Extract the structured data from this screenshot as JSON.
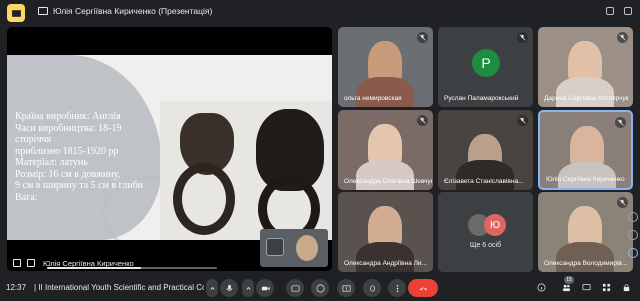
{
  "header": {
    "title": "Юлія Сергіївна Кириченко (Презентація)"
  },
  "slide": {
    "lines": [
      "Країна виробник: Англія",
      "Часи виробництва: 18-19",
      "сторіччя",
      "приблизно 1815-1920 рр",
      "Матеріал: латунь",
      "Розмір: 16 см в довжину,",
      "9 см в ширину та 5 см в глиби",
      "Вага:"
    ]
  },
  "presentation": {
    "presenter_name": "Юлія Сергіївна Кириченко",
    "progress_fraction": 0.55
  },
  "participants": [
    {
      "name": "ольга немировская",
      "muted": true
    },
    {
      "name": "Руслан Паламарокський",
      "muted": true,
      "initial": "Р",
      "avatar_color": "#1e8e3e"
    },
    {
      "name": "Дарина Сергіївна Котлярчук",
      "muted": true
    },
    {
      "name": "Олександра Олегівна Шевчук",
      "muted": true
    },
    {
      "name": "Єлізавета Станіславівна...",
      "muted": true
    },
    {
      "name": "Юлія Сергіївна Кириченко",
      "muted": true
    },
    {
      "name": "Олександра Андріївна Ли...",
      "muted": false
    },
    {
      "name": "Олександра Володимирів...",
      "muted": true
    }
  ],
  "more_tile": {
    "label": "Ще 6 осіб",
    "initial": "Ю",
    "initial_color": "#e06666"
  },
  "bottom_bar": {
    "clock": "12:37",
    "separator": "|",
    "meeting_name": "II International Youth Scientific and Practical Con...",
    "people_count": "15"
  },
  "colors": {
    "background": "#202124",
    "tile": "#3c4043",
    "end_call": "#ea4335",
    "accent": "#8ab4f8"
  }
}
